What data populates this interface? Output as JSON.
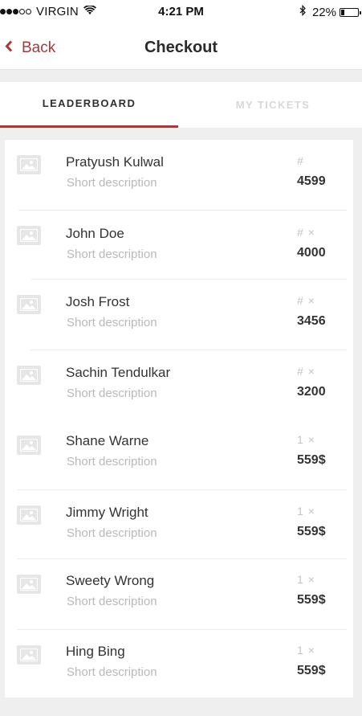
{
  "status_bar": {
    "carrier": "VIRGIN",
    "time": "4:21 PM",
    "battery_percent": "22%",
    "battery_level": 0.22,
    "signal_bars_full": 3,
    "signal_bars_total": 5
  },
  "nav": {
    "back_label": "Back",
    "title": "Checkout"
  },
  "tabs": [
    {
      "label": "LEADERBOARD",
      "active": true
    },
    {
      "label": "MY TICKETS",
      "active": false
    }
  ],
  "rows": [
    {
      "name": "Pratyush Kulwal",
      "description": "Short description",
      "meta": "#",
      "value": "4599"
    },
    {
      "name": "John Doe",
      "description": "Short description",
      "meta": "# ×",
      "value": "4000"
    },
    {
      "name": "Josh Frost",
      "description": "Short description",
      "meta": "# ×",
      "value": "3456"
    },
    {
      "name": "Sachin Tendulkar",
      "description": "Short description",
      "meta": "# ×",
      "value": "3200"
    },
    {
      "name": "Shane Warne",
      "description": "Short description",
      "meta": "1 ×",
      "value": "559$"
    },
    {
      "name": "Jimmy Wright",
      "description": "Short description",
      "meta": "1 ×",
      "value": "559$"
    },
    {
      "name": "Sweety Wrong",
      "description": "Short description",
      "meta": "1 ×",
      "value": "559$"
    },
    {
      "name": "Hing Bing",
      "description": "Short description",
      "meta": "1 ×",
      "value": "559$"
    }
  ],
  "colors": {
    "accent": "#a53a3a",
    "background": "#efefef"
  },
  "icons": [
    "wifi-icon",
    "bluetooth-icon",
    "battery-icon",
    "chevron-left-icon",
    "image-placeholder-icon"
  ]
}
